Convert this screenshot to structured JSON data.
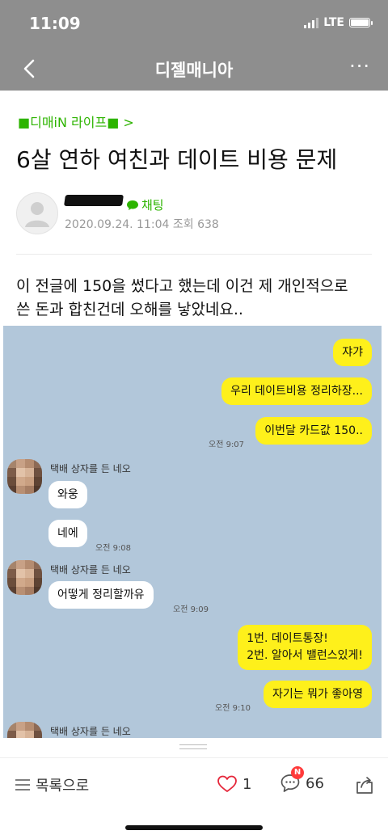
{
  "status": {
    "time": "11:09",
    "network": "LTE"
  },
  "nav": {
    "title": "디젤매니아",
    "more": "···"
  },
  "post": {
    "category": "■디매iN 라이프■ >",
    "title": "6살 연하 여친과 데이트 비용 문제",
    "chat_link": "채팅",
    "meta": "2020.09.24. 11:04 조회 638",
    "body_line1": "이 전글에 150을 썼다고 했는데 이건 제 개인적으로",
    "body_line2": "쓴 돈과 합친건데 오해를 낳았네요.."
  },
  "chat": {
    "m1": "쟈갸",
    "m2": "우리 데이트비용 정리하장...",
    "m3": "이번달 카드값 150..",
    "t1": "오전 9:07",
    "sender": "택배 상자를 든 네오",
    "r1": "와웅",
    "r2": "네에",
    "t2": "오전 9:08",
    "r3": "어떻게 정리할까유",
    "t3": "오전 9:09",
    "m4a": "1번. 데이트통장!",
    "m4b": "2번. 알아서 밸런스있게!",
    "m5": "자기는 뭐가 좋아영",
    "t4": "오전 9:10"
  },
  "toolbar": {
    "list_label": "목록으로",
    "likes": "1",
    "comments": "66",
    "badge": "N"
  },
  "colors": {
    "accent": "#2db400",
    "my_bubble": "#fef01b",
    "chat_bg": "#b2c7da",
    "nav_bg": "#8e8e8e"
  }
}
